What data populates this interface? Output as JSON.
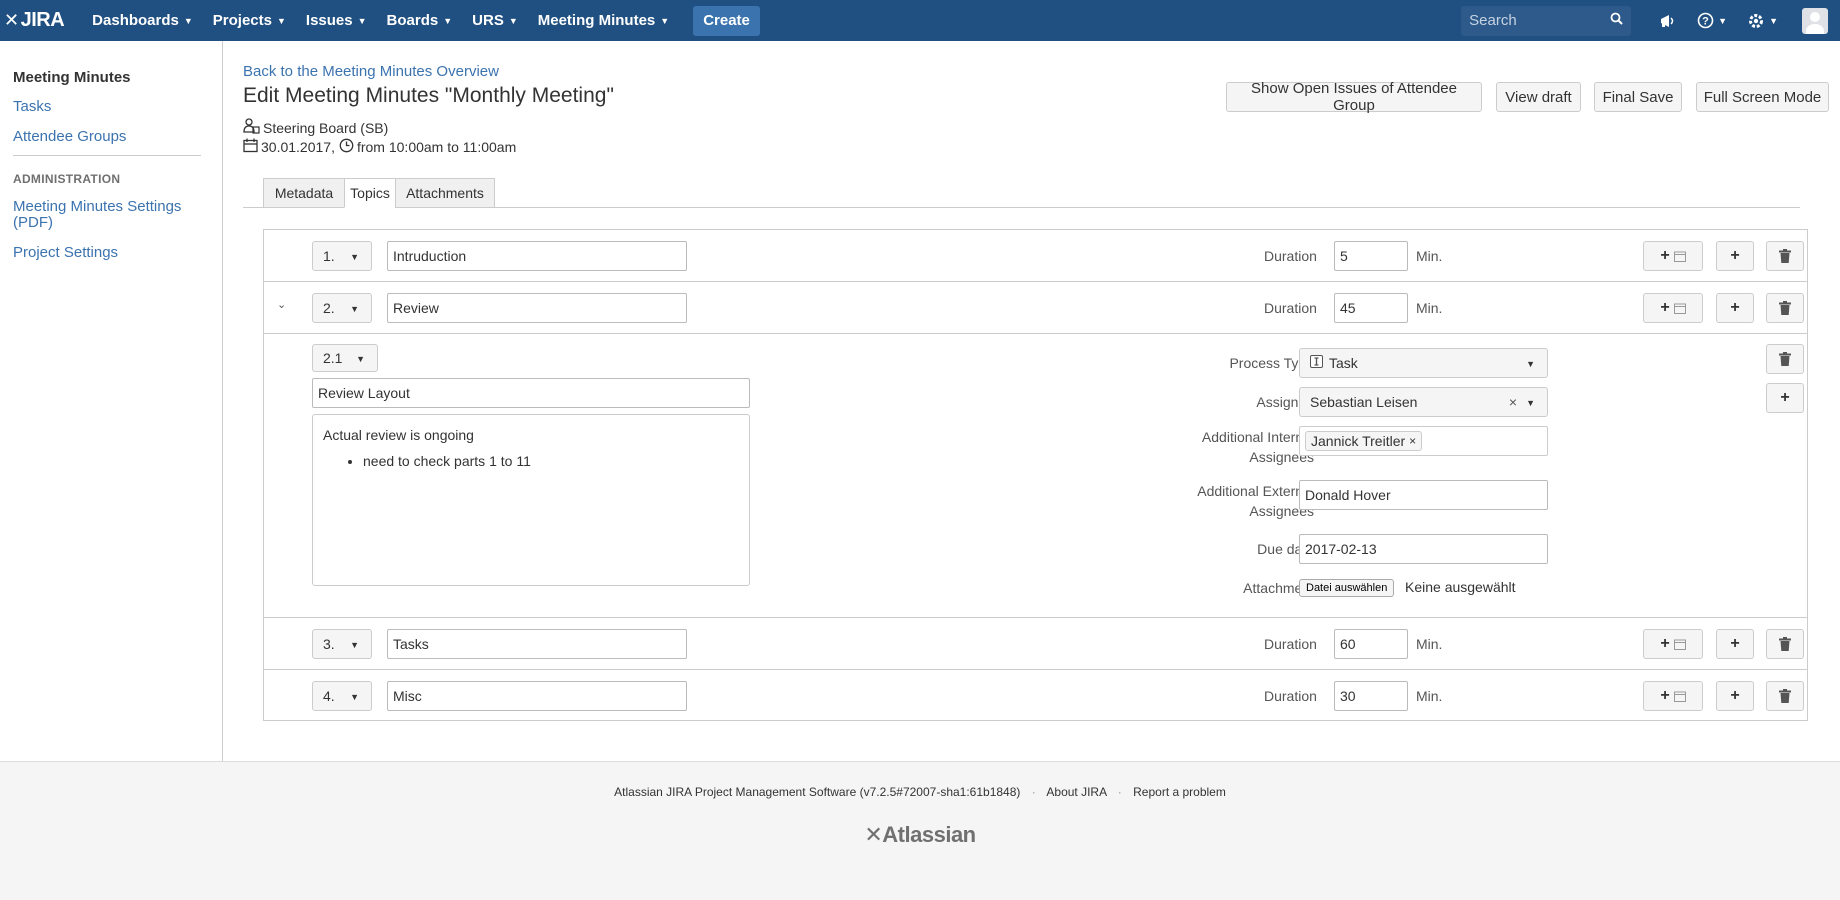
{
  "nav": {
    "logo": "JIRA",
    "items": [
      {
        "label": "Dashboards"
      },
      {
        "label": "Projects"
      },
      {
        "label": "Issues"
      },
      {
        "label": "Boards"
      },
      {
        "label": "URS"
      },
      {
        "label": "Meeting Minutes"
      }
    ],
    "create_label": "Create",
    "search_placeholder": "Search"
  },
  "sidebar": {
    "heading": "Meeting Minutes",
    "links": [
      "Tasks",
      "Attendee Groups"
    ],
    "admin_heading": "ADMINISTRATION",
    "admin_links": [
      "Meeting Minutes Settings (PDF)",
      "Project Settings"
    ]
  },
  "page": {
    "back_link": "Back to the Meeting Minutes Overview",
    "title": "Edit Meeting Minutes \"Monthly Meeting\"",
    "group": "Steering Board (SB)",
    "date": "30.01.2017,",
    "time": "from 10:00am to 11:00am",
    "buttons": {
      "show_open": "Show Open Issues of Attendee Group",
      "view_draft": "View draft",
      "final_save": "Final Save",
      "full_screen": "Full Screen Mode"
    },
    "tabs": [
      "Metadata",
      "Topics",
      "Attachments"
    ],
    "active_tab": "Topics"
  },
  "topics": {
    "duration_label": "Duration",
    "unit": "Min.",
    "rows": [
      {
        "number": "1.",
        "title": "Intruduction",
        "duration": "5"
      },
      {
        "number": "2.",
        "title": "Review",
        "duration": "45"
      },
      {
        "number": "3.",
        "title": "Tasks",
        "duration": "60"
      },
      {
        "number": "4.",
        "title": "Misc",
        "duration": "30"
      }
    ],
    "subtopic": {
      "number": "2.1",
      "title": "Review Layout",
      "body_text": "Actual review is ongoing",
      "bullets": [
        "need to check parts 1 to 11"
      ],
      "process_type_label": "Process Type",
      "process_type": "Task",
      "assignee_label": "Assignee",
      "assignee": "Sebastian Leisen",
      "additional_internal_label": "Additional Internal Assignees",
      "additional_internal": [
        "Jannick Treitler"
      ],
      "additional_external_label": "Additional External Assignees",
      "additional_external": "Donald Hover",
      "due_date_label": "Due date",
      "due_date": "2017-02-13",
      "attachment_label": "Attachment",
      "file_button": "Datei auswählen",
      "file_status": "Keine ausgewählt"
    }
  },
  "footer": {
    "software": "Atlassian JIRA Project Management Software (v7.2.5#72007-sha1:61b1848)",
    "about": "About JIRA",
    "report": "Report a problem",
    "logo": "Atlassian"
  },
  "colors": {
    "nav_bg": "#205081",
    "link": "#3b73af",
    "create_btn": "#3b73af"
  }
}
